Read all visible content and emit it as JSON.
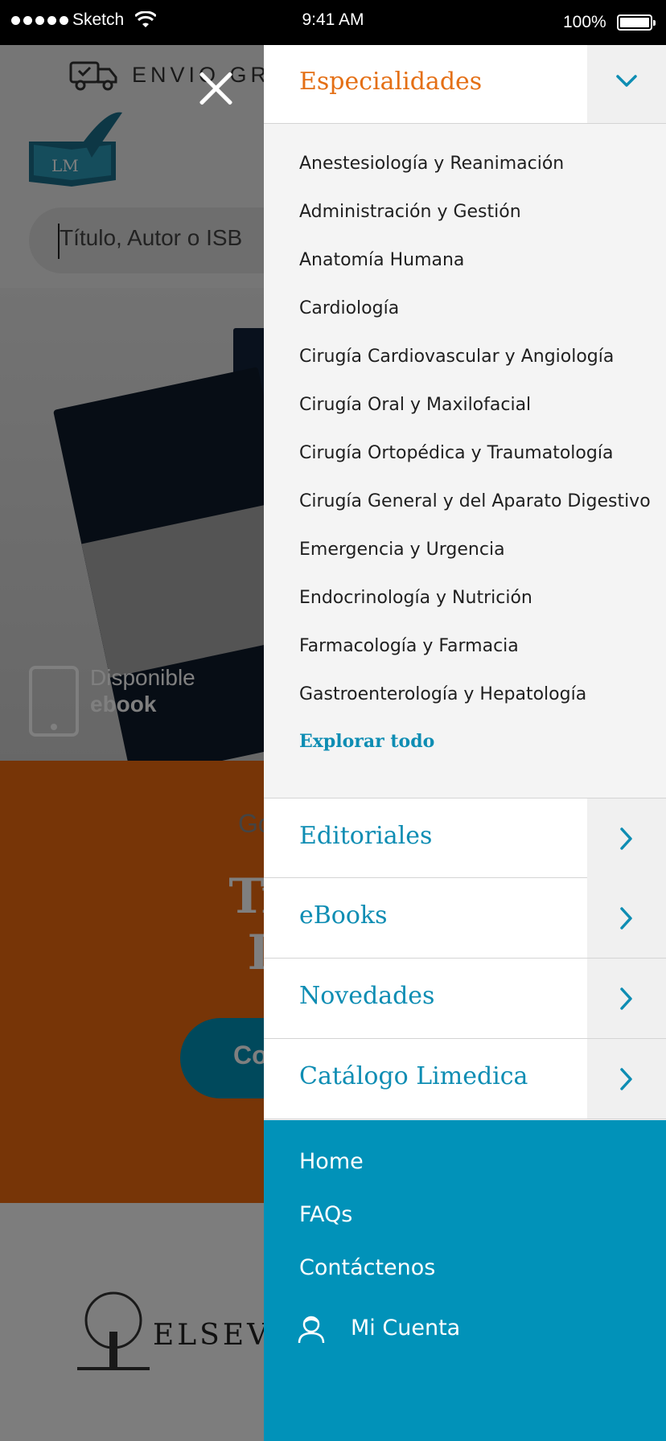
{
  "status_bar": {
    "carrier": "Sketch",
    "time": "9:41 AM",
    "battery": "100%",
    "icons": [
      "signal-dots-icon",
      "wifi-icon",
      "battery-icon"
    ]
  },
  "background_page": {
    "shipping_text": "ENVIO GRA",
    "logo_text": "LM",
    "search_placeholder": "Título, Autor o ISB",
    "hero": {
      "available_line1": "Disponible",
      "available_line2": "ebook"
    },
    "promo": {
      "subtitle": "Go",
      "title_line1": "Tratado",
      "title_line2": "Intern",
      "button_text": "Co"
    },
    "footer_brand": "ELSEVIE"
  },
  "drawer": {
    "specialties": {
      "label": "Especialidades",
      "accent_color": "#e46f15",
      "toggle_icon": "chevron-down-icon",
      "items": [
        "Anestesiología y Reanimación",
        "Administración y Gestión",
        "Anatomía Humana",
        "Cardiología",
        "Cirugía Cardiovascular y Angiología",
        "Cirugía Oral y Maxilofacial",
        "Cirugía Ortopédica y Traumatología",
        "Cirugía General y del Aparato Digestivo",
        "Emergencia y Urgencia",
        "Endocrinología y Nutrición",
        "Farmacología y Farmacia",
        "Gastroenterología y Hepatología"
      ],
      "explore_all": "Explorar todo"
    },
    "sections": [
      {
        "label": "Editoriales",
        "icon": "chevron-right-icon"
      },
      {
        "label": "eBooks",
        "icon": "chevron-right-icon"
      },
      {
        "label": "Novedades",
        "icon": "chevron-right-icon"
      },
      {
        "label": "Catálogo Limedica",
        "icon": "chevron-right-icon"
      }
    ],
    "link_color": "#0e8db3",
    "bottom_panel": {
      "background": "#0192b9",
      "links": [
        "Home",
        "FAQs",
        "Contáctenos"
      ],
      "account_label": "Mi Cuenta",
      "account_icon": "user-icon"
    }
  }
}
